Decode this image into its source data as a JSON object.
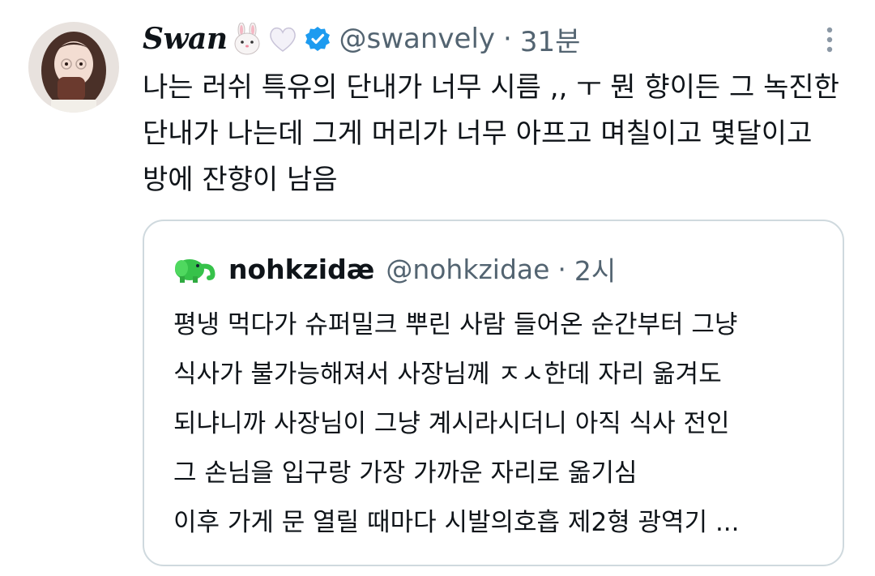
{
  "tweet": {
    "author": {
      "display_name": "Swan",
      "handle": "@swanvely",
      "name_emojis": [
        "rabbit-face-emoji",
        "white-heart-emoji"
      ],
      "verified": true
    },
    "separator": "·",
    "time": "31분",
    "text_lines": [
      "나는 러쉬 특유의 단내가 너무 시름 ,, ㅜ 뭔 향이든 그 녹진한",
      "단내가 나는데 그게 머리가 너무 아프고 며칠이고 몇달이고",
      "방에 잔향이 남음"
    ]
  },
  "quote": {
    "author": {
      "display_name": "nohkzidæ",
      "handle": "@nohkzidae",
      "name_emoji": "green-elephant-emoji"
    },
    "separator": "·",
    "time": "2시",
    "text_lines": [
      "평냉 먹다가 슈퍼밀크 뿌린 사람 들어온 순간부터 그냥",
      "식사가 불가능해져서 사장님께 ㅈㅅ한데 자리 옮겨도",
      "되냐니까 사장님이 그냥 계시라시더니 아직 식사 전인",
      "그 손님을 입구랑 가장 가까운 자리로 옮기심",
      "이후 가게 문 열릴 때마다 시발의호흡 제2형 광역기 ..."
    ]
  },
  "colors": {
    "text_primary": "#0f1419",
    "text_secondary": "#536471",
    "verified_blue": "#1d9bf0",
    "border": "#cfd9de"
  }
}
